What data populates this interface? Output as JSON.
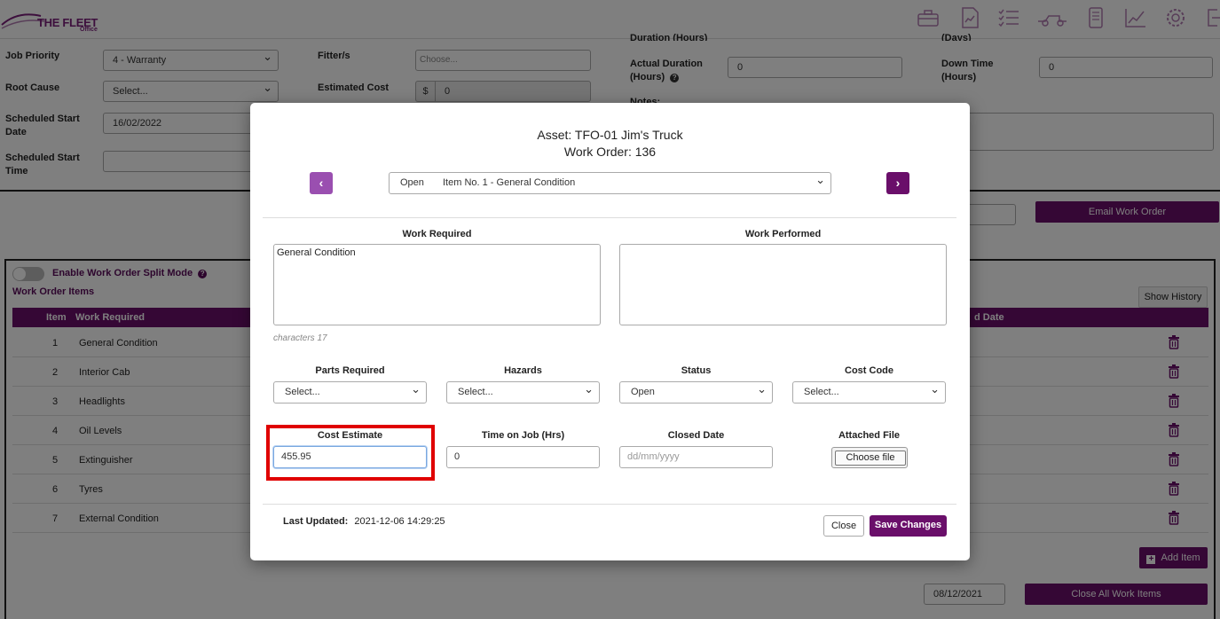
{
  "header": {
    "logo_text": "THE FLEET",
    "logo_sub": "Office",
    "icons": [
      "toolbox-icon",
      "document-chart-icon",
      "checklist-icon",
      "truck-icon",
      "phone-icon",
      "line-chart-icon",
      "gear-icon",
      "logout-icon"
    ]
  },
  "form": {
    "job_priority_label": "Job Priority",
    "job_priority_value": "4 - Warranty",
    "root_cause_label": "Root Cause",
    "root_cause_value": "Select...",
    "scheduled_start_date_label": "Scheduled Start Date",
    "scheduled_start_date_value": "16/02/2022",
    "scheduled_start_time_label": "Scheduled Start Time",
    "fitters_label": "Fitter/s",
    "fitters_placeholder": "Choose...",
    "estimated_cost_label": "Estimated Cost",
    "estimated_cost_prefix": "$",
    "estimated_cost_value": "0",
    "duration_label_partial": "Duration (Hours)",
    "actual_duration_label": "Actual Duration (Hours)",
    "actual_duration_value": "0",
    "days_label_partial": "(Days)",
    "down_time_label": "Down Time (Hours)",
    "down_time_value": "0",
    "notes_label_partial": "Notes:"
  },
  "actions": {
    "email_work_order": "Email Work Order",
    "show_history": "Show History",
    "add_item": "Add Item",
    "close_all_work_items": "Close All Work Items",
    "close_all_date": "08/12/2021"
  },
  "work_items": {
    "split_mode_label": "Enable Work Order Split Mode",
    "section_title": "Work Order Items",
    "col_item": "Item",
    "col_work_required": "Work Required",
    "col_date_partial": "d Date",
    "rows": [
      {
        "num": "1",
        "desc": "General Condition"
      },
      {
        "num": "2",
        "desc": "Interior Cab"
      },
      {
        "num": "3",
        "desc": "Headlights"
      },
      {
        "num": "4",
        "desc": "Oil Levels"
      },
      {
        "num": "5",
        "desc": "Extinguisher"
      },
      {
        "num": "6",
        "desc": "Tyres"
      },
      {
        "num": "7",
        "desc": "External Condition"
      }
    ]
  },
  "modal": {
    "asset_title": "Asset: TFO-01 Jim's Truck",
    "work_order_title": "Work Order: 136",
    "item_status": "Open",
    "item_selected": "Item No. 1 - General Condition",
    "prev_symbol": "‹",
    "next_symbol": "›",
    "work_required_label": "Work Required",
    "work_required_value": "General Condition",
    "work_performed_label": "Work Performed",
    "char_count": "characters 17",
    "parts_required_label": "Parts Required",
    "parts_required_value": "Select...",
    "hazards_label": "Hazards",
    "hazards_value": "Select...",
    "status_label": "Status",
    "status_value": "Open",
    "cost_code_label": "Cost Code",
    "cost_code_value": "Select...",
    "cost_estimate_label": "Cost Estimate",
    "cost_estimate_value": "455.95",
    "time_on_job_label": "Time on Job (Hrs)",
    "time_on_job_value": "0",
    "closed_date_label": "Closed Date",
    "closed_date_placeholder": "dd/mm/yyyy",
    "attached_file_label": "Attached File",
    "choose_file": "Choose file",
    "last_updated_label": "Last Updated:",
    "last_updated_value": "2021-12-06 14:29:25",
    "close_button": "Close",
    "save_button": "Save Changes"
  },
  "colors": {
    "brand_purple": "#6a0f6a",
    "nav_light_purple": "#9a4fb0",
    "highlight_red": "#e00000"
  }
}
